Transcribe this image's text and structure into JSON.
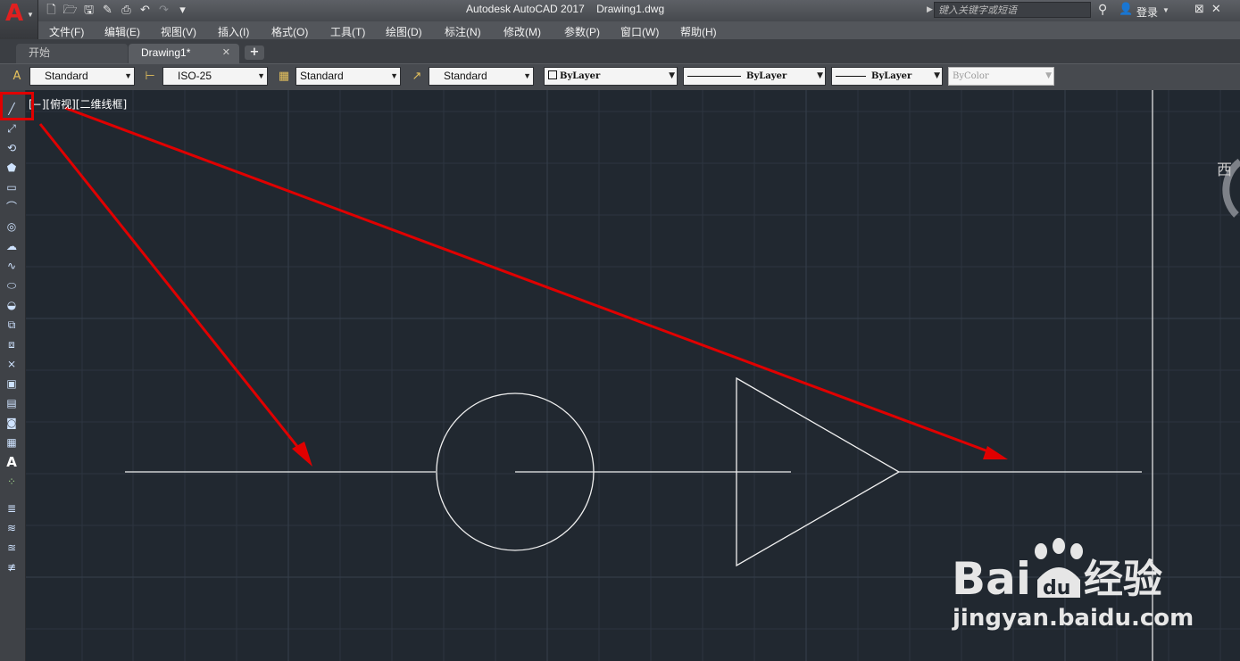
{
  "window": {
    "title": "Autodesk AutoCAD 2017    Drawing1.dwg",
    "search_placeholder": "键入关键字或短语",
    "login_label": "登录"
  },
  "menu": [
    {
      "label": "文件(F)"
    },
    {
      "label": "编辑(E)"
    },
    {
      "label": "视图(V)"
    },
    {
      "label": "插入(I)"
    },
    {
      "label": "格式(O)"
    },
    {
      "label": "工具(T)"
    },
    {
      "label": "绘图(D)"
    },
    {
      "label": "标注(N)"
    },
    {
      "label": "修改(M)"
    },
    {
      "label": "参数(P)"
    },
    {
      "label": "窗口(W)"
    },
    {
      "label": "帮助(H)"
    }
  ],
  "tabs": [
    {
      "label": "开始"
    },
    {
      "label": "Drawing1*",
      "close": "✕"
    }
  ],
  "tab_add": "+",
  "style_toolbar": {
    "text_style": "Standard",
    "dim_style": "ISO-25",
    "table_style": "Standard",
    "multileader_style": "Standard",
    "color": "ByLayer",
    "linetype": "ByLayer",
    "lineweight": "ByLayer",
    "plot_style": "ByColor"
  },
  "viewport": {
    "label": "[−][俯视][二维线框]",
    "viewcube_label": "西"
  },
  "left_toolbar_text_icon": "A",
  "watermark": {
    "logo_text_bai": "Bai",
    "logo_text_du": "du",
    "logo_text_cn": "经验",
    "url": "jingyan.baidu.com"
  },
  "colors": {
    "canvas_bg": "#212830",
    "annotation": "#e00000",
    "geometry": "#ffffff"
  }
}
